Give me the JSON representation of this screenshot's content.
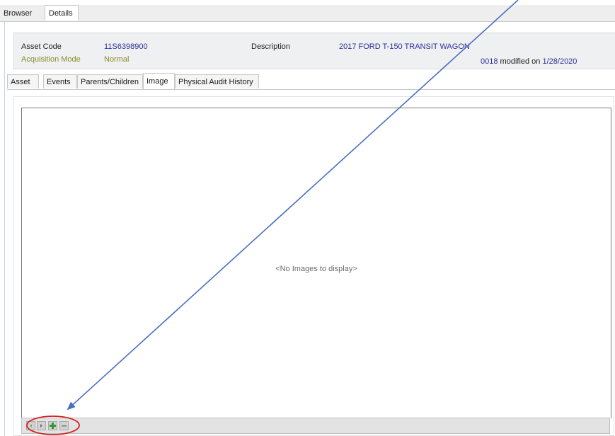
{
  "top_tabs": [
    "Browser",
    "Details"
  ],
  "header": {
    "asset_code_label": "Asset Code",
    "asset_code": "11S6398900",
    "description_label": "Description",
    "description": "2017 FORD T-150 TRANSIT WAGON",
    "acquisition_mode_label": "Acquisition Mode",
    "acquisition_mode": "Normal",
    "record_id": "0018",
    "modified_on_label": "modified on",
    "modified_date": "1/28/2020"
  },
  "sub_tabs": [
    "Asset",
    "Events",
    "Parents/Children",
    "Image",
    "Physical Audit History"
  ],
  "active_sub_tab": "Image",
  "viewer": {
    "empty_message": "<No Images to display>"
  },
  "toolbar": {
    "buttons": [
      "prev",
      "next",
      "add",
      "remove"
    ]
  },
  "annotation": {
    "arrow_color": "#4a6fbf",
    "circle_color": "#d42020"
  }
}
